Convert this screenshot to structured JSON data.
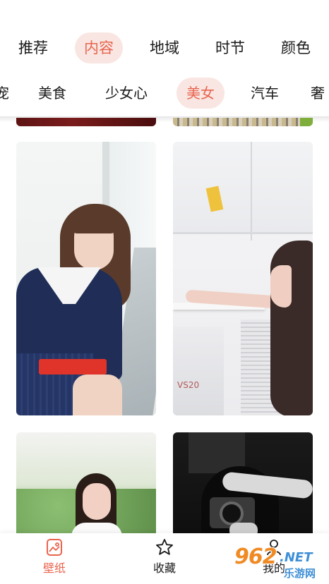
{
  "top_tabs": [
    {
      "label": "推荐"
    },
    {
      "label": "内容"
    },
    {
      "label": "地域"
    },
    {
      "label": "时节"
    },
    {
      "label": "颜色"
    }
  ],
  "sub_tabs": [
    {
      "label": "宠"
    },
    {
      "label": "美食"
    },
    {
      "label": "少女心"
    },
    {
      "label": "美女"
    },
    {
      "label": "汽车"
    },
    {
      "label": "奢"
    }
  ],
  "active_top_tab": "内容",
  "active_sub_tab": "美女",
  "cards": {
    "box_label": "VS20"
  },
  "bottom_nav": {
    "wallpaper": "壁纸",
    "favorites": "收藏",
    "mine": "我的"
  },
  "watermark": {
    "number": "962",
    "net": ".NET",
    "site": "乐游网"
  },
  "colors": {
    "accent": "#e8654f",
    "accent_bg": "#f9e6e2",
    "text": "#1a1a1a"
  }
}
